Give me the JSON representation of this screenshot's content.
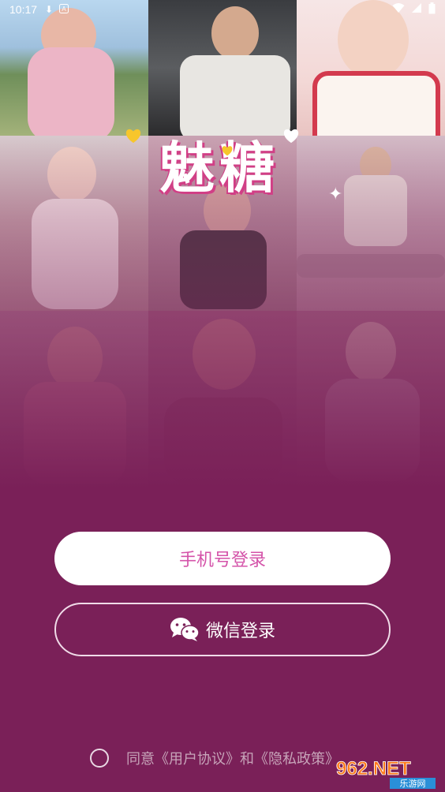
{
  "status_bar": {
    "time": "10:17",
    "left_icons": [
      "download-icon",
      "app-notification-icon"
    ],
    "right_icons": [
      "wifi-icon",
      "cellular-icon",
      "battery-icon"
    ]
  },
  "logo": {
    "text": "魅糖"
  },
  "buttons": {
    "phone_login": "手机号登录",
    "wechat_login": "微信登录"
  },
  "agreement": {
    "prefix": "同意",
    "user_agreement": "《用户协议》",
    "conjunction": "和",
    "privacy_policy": "《隐私政策》"
  },
  "watermark": {
    "brand": "962.NET",
    "subtitle": "乐游网"
  },
  "colors": {
    "background": "#7a2058",
    "phone_button_text": "#d453a9",
    "white": "#ffffff"
  }
}
